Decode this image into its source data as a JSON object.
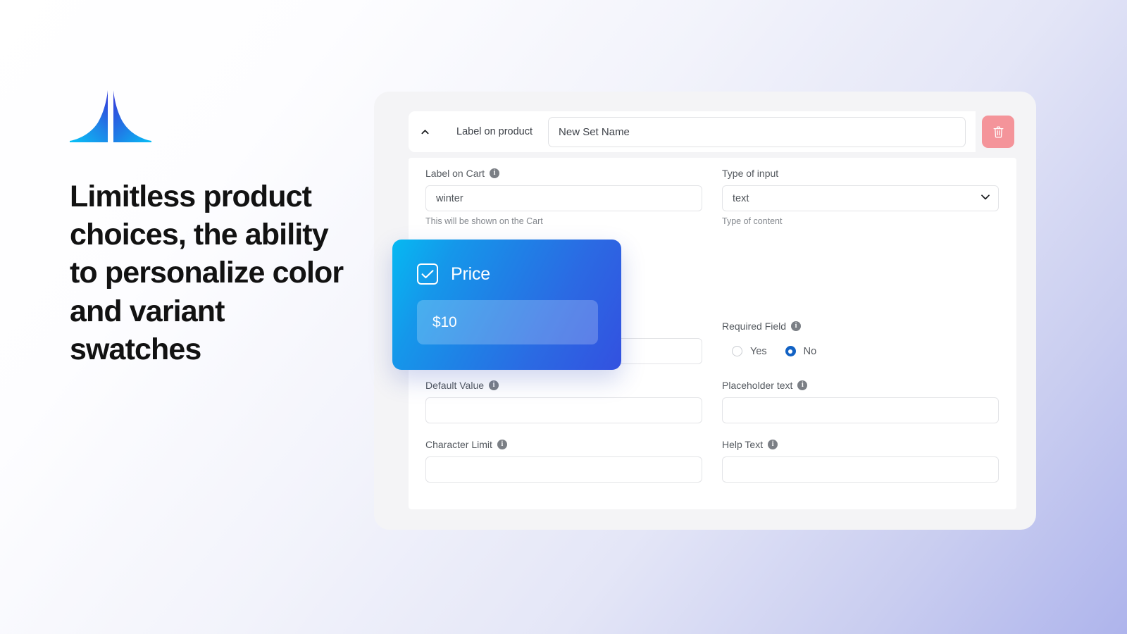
{
  "brand": {
    "logo_icon": "mega-m-logo-icon",
    "gradient_from": "#0bb6f5",
    "gradient_to": "#2f4fe0"
  },
  "promo": {
    "headline": "Limitless product choices, the ability to personalize color and variant swatches"
  },
  "background": {
    "from": "#ffffff",
    "to": "#aeb4ec"
  },
  "option_set": {
    "collapse_icon": "chevron-up-icon",
    "collapse_state": "expanded",
    "label_on_product_label": "Label on product",
    "set_name_value": "New Set Name",
    "set_name_placeholder": "Set name",
    "delete_icon": "trash-icon",
    "delete_color": "#f4949a"
  },
  "fields": {
    "label_on_cart": {
      "label": "Label on Cart",
      "info_icon": "info-icon",
      "value": "winter",
      "placeholder": "",
      "helper": "This will be shown on the Cart"
    },
    "type_of_input": {
      "label": "Type of input",
      "value": "text",
      "chevron_icon": "chevron-down-icon",
      "helper": "Type of content",
      "options": [
        "text"
      ]
    },
    "hidden_left_field": {
      "value": "",
      "placeholder": ""
    },
    "required_field": {
      "label": "Required Field",
      "info_icon": "info-icon",
      "options": [
        {
          "label": "Yes",
          "selected": false
        },
        {
          "label": "No",
          "selected": true
        }
      ],
      "selected_color": "#1262c4"
    },
    "default_value": {
      "label": "Default Value",
      "info_icon": "info-icon",
      "value": "",
      "placeholder": ""
    },
    "placeholder_text": {
      "label": "Placeholder text",
      "info_icon": "info-icon",
      "value": "",
      "placeholder": ""
    },
    "character_limit": {
      "label": "Character Limit",
      "info_icon": "info-icon",
      "value": "",
      "placeholder": ""
    },
    "help_text": {
      "label": "Help Text",
      "info_icon": "info-icon",
      "value": "",
      "placeholder": ""
    }
  },
  "price_card": {
    "checkbox_icon": "checkmark-icon",
    "checked": true,
    "title": "Price",
    "value": "$10",
    "gradient_from": "#06b9f2",
    "gradient_to": "#3351e0"
  }
}
